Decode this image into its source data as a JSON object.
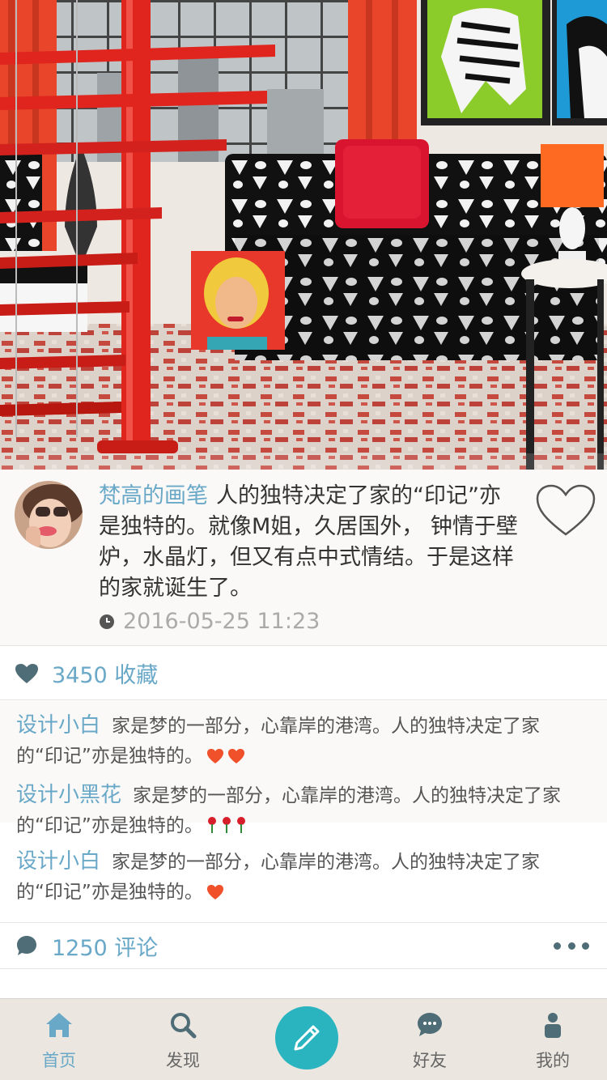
{
  "post": {
    "author": "梵高的画笔",
    "text": "人的独特决定了家的“印记”亦是独特的。就像M姐，久居国外， 钟情于壁炉，水晶灯，但又有点中式情结。于是这样的家就诞生了。",
    "time": "2016-05-25  11:23"
  },
  "favorites": {
    "label": "3450 收藏"
  },
  "comments": [
    {
      "name": "设计小白",
      "text": "家是梦的一部分，心靠岸的港湾。人的独特决定了家的“印记”亦是独特的。",
      "emoji": [
        "heart",
        "heart"
      ]
    },
    {
      "name": "设计小黑花",
      "text": "家是梦的一部分，心靠岸的港湾。人的独特决定了家的“印记”亦是独特的。",
      "emoji": [
        "roses"
      ]
    },
    {
      "name": "设计小白",
      "text": "家是梦的一部分，心靠岸的港湾。人的独特决定了家的“印记”亦是独特的。",
      "emoji": [
        "heart"
      ]
    }
  ],
  "comment_summary": {
    "label": "1250 评论"
  },
  "tabs": [
    {
      "label": "首页",
      "icon": "home-icon",
      "active": true
    },
    {
      "label": "发现",
      "icon": "search-icon",
      "active": false
    },
    {
      "label": "好友",
      "icon": "chat-icon",
      "active": false
    },
    {
      "label": "我的",
      "icon": "user-icon",
      "active": false
    }
  ],
  "colors": {
    "accent": "#6aa8c8",
    "compose": "#2ab4c0",
    "tabbar": "#ebe7e0",
    "icon": "#4f6d77",
    "heart_emoji": "#f0502a"
  }
}
